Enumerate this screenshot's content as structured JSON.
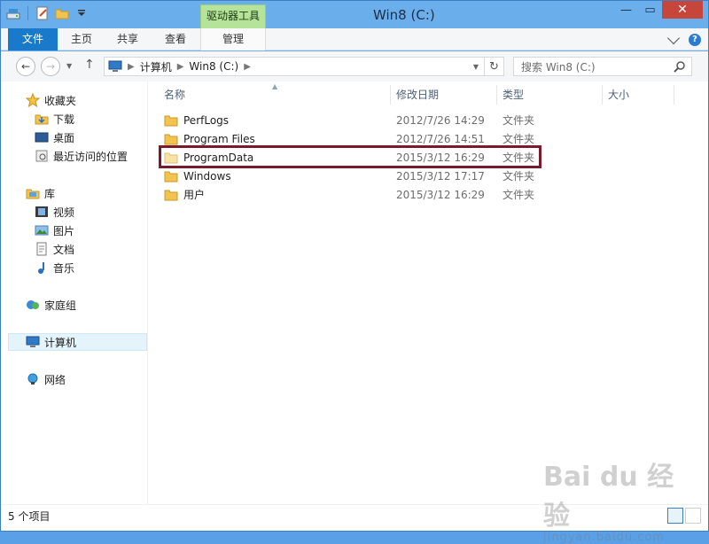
{
  "window": {
    "title": "Win8 (C:)",
    "context_tab_group": "驱动器工具"
  },
  "ribbon": {
    "tabs": [
      "文件",
      "主页",
      "共享",
      "查看",
      "管理"
    ]
  },
  "address": {
    "crumbs": [
      "计算机",
      "Win8 (C:)"
    ]
  },
  "search": {
    "placeholder": "搜索 Win8 (C:)"
  },
  "nav": {
    "favorites": {
      "label": "收藏夹",
      "items": [
        "下载",
        "桌面",
        "最近访问的位置"
      ]
    },
    "libraries": {
      "label": "库",
      "items": [
        "视频",
        "图片",
        "文档",
        "音乐"
      ]
    },
    "homegroup": "家庭组",
    "computer": "计算机",
    "network": "网络"
  },
  "columns": {
    "name": "名称",
    "date": "修改日期",
    "type": "类型",
    "size": "大小"
  },
  "files": [
    {
      "name": "PerfLogs",
      "date": "2012/7/26 14:29",
      "type": "文件夹"
    },
    {
      "name": "Program Files",
      "date": "2012/7/26 14:51",
      "type": "文件夹"
    },
    {
      "name": "ProgramData",
      "date": "2015/3/12 16:29",
      "type": "文件夹"
    },
    {
      "name": "Windows",
      "date": "2015/3/12 17:17",
      "type": "文件夹"
    },
    {
      "name": "用户",
      "date": "2015/3/12 16:29",
      "type": "文件夹"
    }
  ],
  "status": {
    "count": "5 个项目"
  },
  "watermark": {
    "brand": "Bai du 经验",
    "url": "jingyan.baidu.com"
  },
  "colors": {
    "titlebar": "#6aaeeb",
    "file_tab": "#1979ca",
    "context_tab": "#b5e39a",
    "close_button": "#c7463b",
    "highlight_box": "#7b1a2a"
  }
}
